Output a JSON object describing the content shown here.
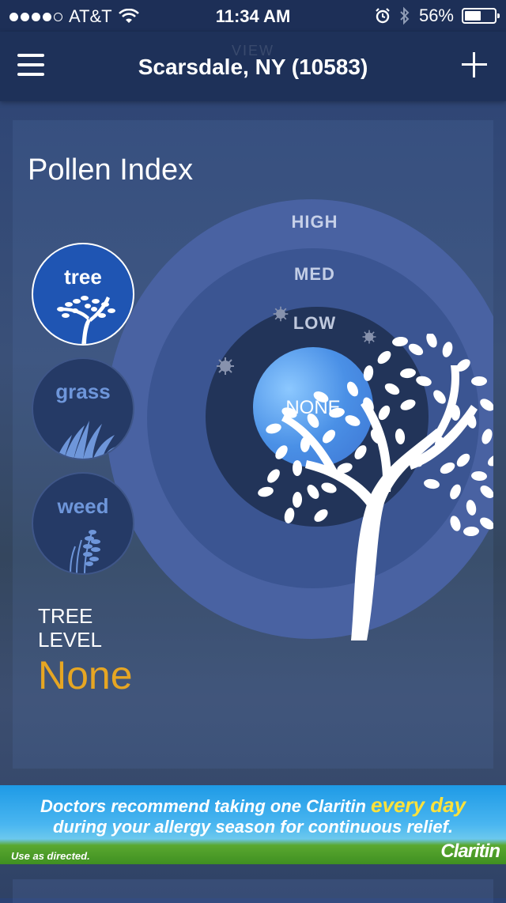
{
  "status_bar": {
    "carrier": "AT&T",
    "time": "11:34 AM",
    "battery_percent": "56%",
    "battery_level": 0.56,
    "signal_bars_filled": 4,
    "signal_bars_total": 5
  },
  "nav": {
    "title": "Scarsdale, NY (10583)",
    "ghost_text": "VIEW"
  },
  "pollen": {
    "title": "Pollen Index",
    "levels": {
      "high": "HIGH",
      "med": "MED",
      "low": "LOW",
      "none": "NONE"
    },
    "types": [
      {
        "label": "tree",
        "selected": true
      },
      {
        "label": "grass",
        "selected": false
      },
      {
        "label": "weed",
        "selected": false
      }
    ],
    "readout": {
      "line1": "TREE",
      "line2": "LEVEL",
      "value": "None"
    }
  },
  "ad": {
    "line1_start": "Doctors recommend taking one Claritin ",
    "line1_highlight": "every day",
    "line2": "during your allergy season for continuous relief.",
    "small": "Use as directed.",
    "brand": "Claritin"
  },
  "colors": {
    "accent_level": "#e6a623",
    "active_type": "#1f55b3",
    "nav_bg": "#1e3159"
  }
}
